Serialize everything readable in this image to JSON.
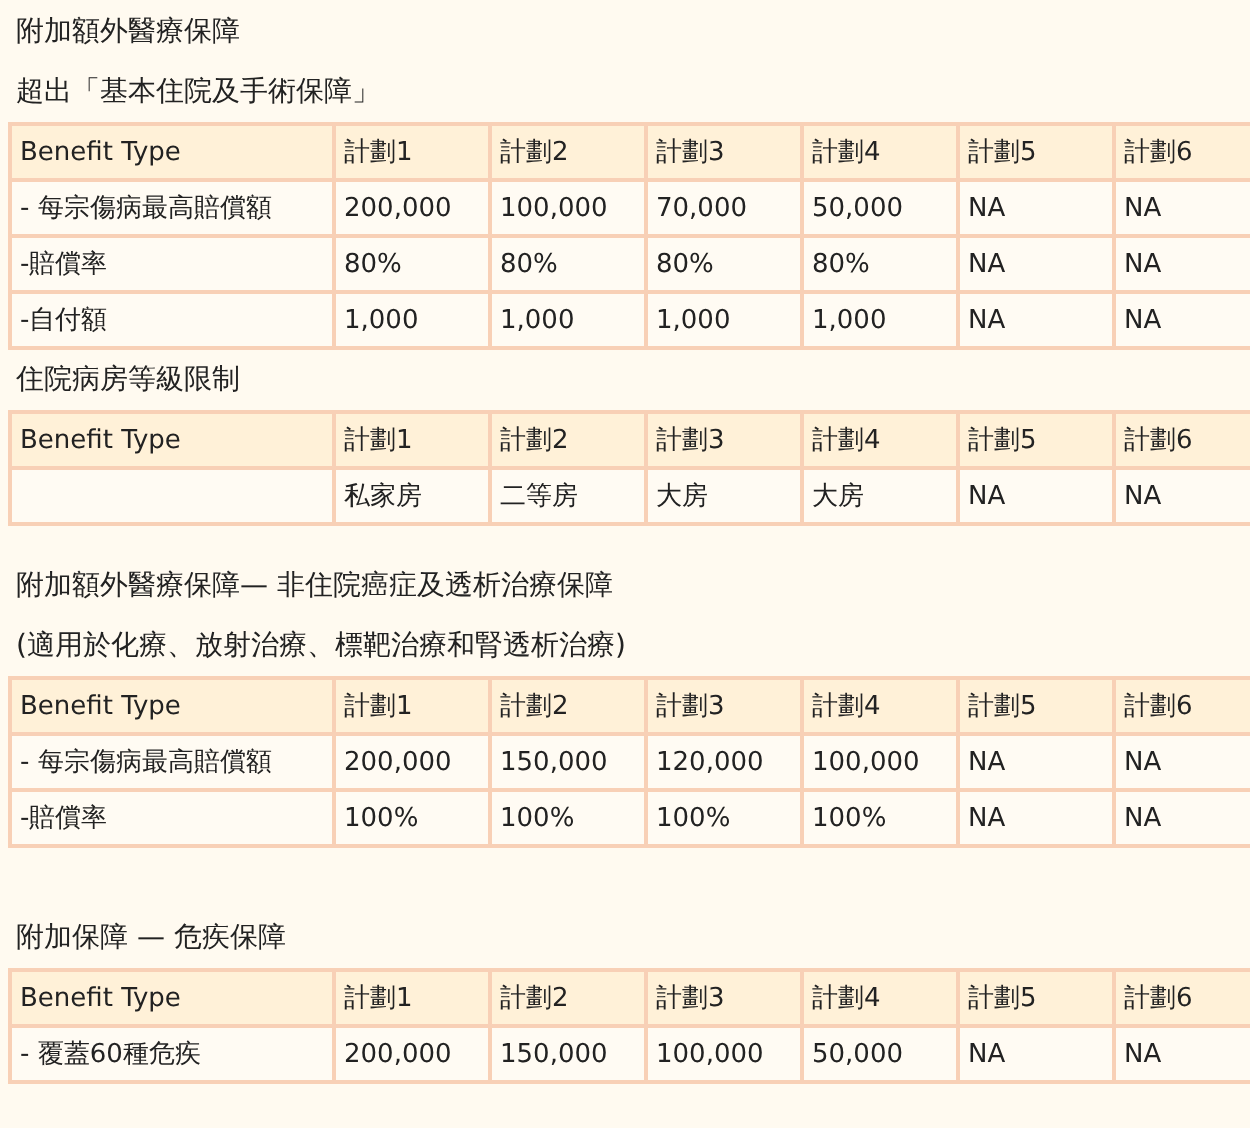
{
  "sections": [
    {
      "headings": [
        "附加額外醫療保障",
        "超出「基本住院及手術保障」"
      ],
      "table": {
        "columns": [
          "Benefit Type",
          "計劃1",
          "計劃2",
          "計劃3",
          "計劃4",
          "計劃5",
          "計劃6"
        ],
        "rows": [
          [
            "- 每宗傷病最高賠償額",
            "200,000",
            "100,000",
            "70,000",
            "50,000",
            "NA",
            "NA"
          ],
          [
            "-賠償率",
            "80%",
            "80%",
            "80%",
            "80%",
            "NA",
            "NA"
          ],
          [
            "-自付額",
            "1,000",
            "1,000",
            "1,000",
            "1,000",
            "NA",
            "NA"
          ]
        ]
      }
    },
    {
      "headings": [
        "住院病房等級限制"
      ],
      "table": {
        "columns": [
          "Benefit Type",
          "計劃1",
          "計劃2",
          "計劃3",
          "計劃4",
          "計劃5",
          "計劃6"
        ],
        "rows": [
          [
            null,
            "私家房",
            "二等房",
            "大房",
            "大房",
            "NA",
            "NA"
          ]
        ]
      }
    },
    {
      "headings": [
        "附加額外醫療保障— 非住院癌症及透析治療保障",
        "(適用於化療、放射治療、標靶治療和腎透析治療)"
      ],
      "table": {
        "columns": [
          "Benefit Type",
          "計劃1",
          "計劃2",
          "計劃3",
          "計劃4",
          "計劃5",
          "計劃6"
        ],
        "rows": [
          [
            "- 每宗傷病最高賠償額",
            "200,000",
            "150,000",
            "120,000",
            "100,000",
            "NA",
            "NA"
          ],
          [
            "-賠償率",
            "100%",
            "100%",
            "100%",
            "100%",
            "NA",
            "NA"
          ]
        ]
      }
    },
    {
      "headings": [
        "附加保障 — 危疾保障"
      ],
      "table": {
        "columns": [
          "Benefit Type",
          "計劃1",
          "計劃2",
          "計劃3",
          "計劃4",
          "計劃5",
          "計劃6"
        ],
        "rows": [
          [
            "- 覆蓋60種危疾",
            "200,000",
            "150,000",
            "100,000",
            "50,000",
            "NA",
            "NA"
          ]
        ]
      }
    }
  ]
}
